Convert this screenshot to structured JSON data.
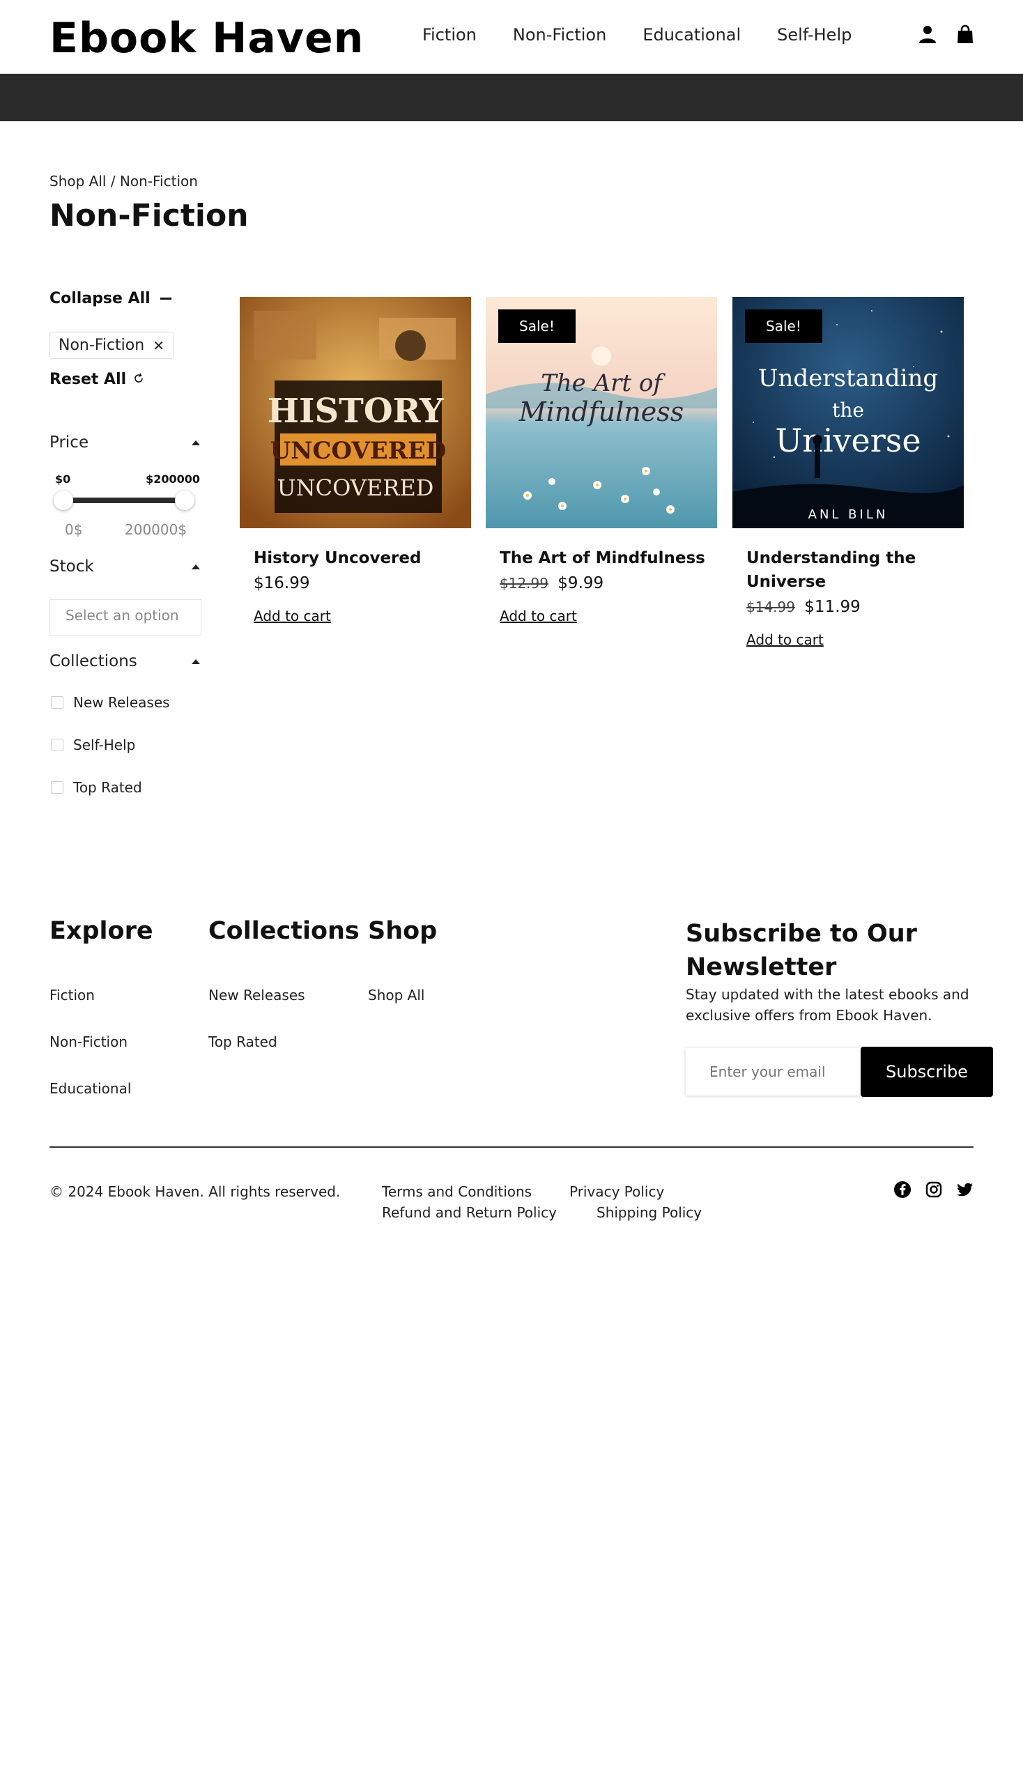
{
  "header": {
    "logo": "Ebook Haven",
    "nav": [
      "Fiction",
      "Non-Fiction",
      "Educational",
      "Self-Help"
    ],
    "icons": [
      "user-icon",
      "shopping-bag-icon"
    ]
  },
  "breadcrumb": "Shop All / Non-Fiction",
  "page_title": "Non-Fiction",
  "sidebar": {
    "collapse_all": "Collapse All",
    "active_filter": "Non-Fiction",
    "reset_all": "Reset All",
    "price": {
      "label": "Price",
      "min_label": "$0",
      "max_label": "$200000",
      "min_value": "0$",
      "max_value": "200000$"
    },
    "stock": {
      "label": "Stock",
      "placeholder": "Select an option"
    },
    "collections": {
      "label": "Collections",
      "items": [
        "New Releases",
        "Self-Help",
        "Top Rated"
      ]
    }
  },
  "products": [
    {
      "name": "History Uncovered",
      "price": "$16.99",
      "old_price": "",
      "sale": "",
      "cta": "Add to cart",
      "cover": {
        "line1": "HISTORY",
        "line2": "UNCOVERED",
        "line3": "UNCOVERED"
      }
    },
    {
      "name": "The Art of Mindfulness",
      "price": "$9.99",
      "old_price": "$12.99",
      "sale": "Sale!",
      "cta": "Add to cart",
      "cover": {
        "line1": "The Art of",
        "line2": "Mindfulness"
      }
    },
    {
      "name": "Understanding the Universe",
      "price": "$11.99",
      "old_price": "$14.99",
      "sale": "Sale!",
      "cta": "Add to cart",
      "cover": {
        "line1": "Understanding",
        "line2": "the",
        "line3": "Universe",
        "author": "ANL BILN"
      }
    }
  ],
  "footer": {
    "explore": {
      "title": "Explore",
      "links": [
        "Fiction",
        "Non-Fiction",
        "Educational"
      ]
    },
    "collections": {
      "title": "Collections",
      "links": [
        "New Releases",
        "Top Rated"
      ]
    },
    "shop": {
      "title": "Shop",
      "links": [
        "Shop All"
      ]
    },
    "newsletter": {
      "title": "Subscribe to Our Newsletter",
      "description": "Stay updated with the latest ebooks and exclusive offers from Ebook Haven.",
      "placeholder": "Enter your email",
      "button": "Subscribe"
    },
    "copyright": "© 2024 Ebook Haven. All rights reserved.",
    "legal": [
      "Terms and Conditions",
      "Privacy Policy",
      "Refund and Return Policy",
      "Shipping Policy"
    ],
    "social": [
      "facebook-icon",
      "instagram-icon",
      "twitter-icon"
    ]
  }
}
